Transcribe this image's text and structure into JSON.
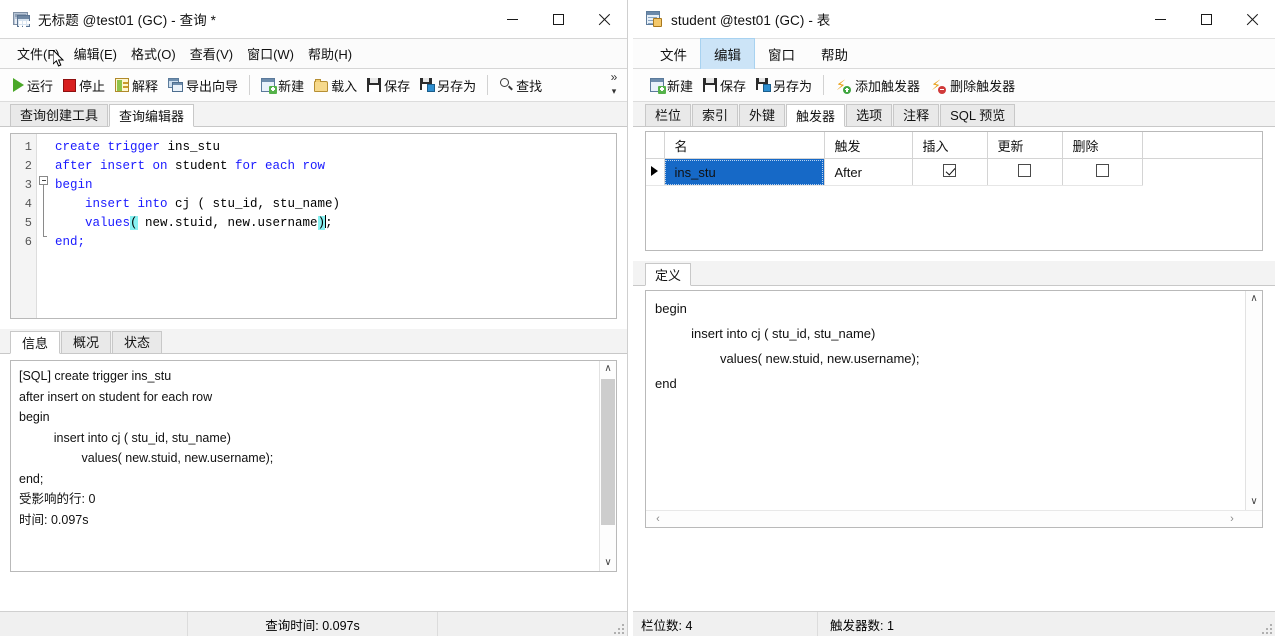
{
  "left_window": {
    "title": "无标题 @test01 (GC) - 查询 *",
    "title_icon": "query-window-icon",
    "window_buttons": {
      "minimize": "minimize-icon",
      "maximize": "maximize-icon",
      "close": "close-icon"
    },
    "menus": [
      {
        "label": "文件(F)",
        "name": "menu-file"
      },
      {
        "label": "编辑(E)",
        "name": "menu-edit"
      },
      {
        "label": "格式(O)",
        "name": "menu-format"
      },
      {
        "label": "查看(V)",
        "name": "menu-view"
      },
      {
        "label": "窗口(W)",
        "name": "menu-window"
      },
      {
        "label": "帮助(H)",
        "name": "menu-help"
      }
    ],
    "toolbar": [
      {
        "label": "运行",
        "icon": "run-icon"
      },
      {
        "label": "停止",
        "icon": "stop-icon"
      },
      {
        "label": "解释",
        "icon": "explain-icon"
      },
      {
        "label": "导出向导",
        "icon": "export-wizard-icon"
      },
      {
        "label": "新建",
        "icon": "new-icon"
      },
      {
        "label": "载入",
        "icon": "load-icon"
      },
      {
        "label": "保存",
        "icon": "save-icon"
      },
      {
        "label": "另存为",
        "icon": "save-as-icon"
      },
      {
        "label": "查找",
        "icon": "search-icon"
      }
    ],
    "toolbar_overflow": "»",
    "tabs": [
      {
        "label": "查询创建工具",
        "active": false
      },
      {
        "label": "查询编辑器",
        "active": true
      }
    ],
    "editor": {
      "line_numbers": [
        "1",
        "2",
        "3",
        "4",
        "5",
        "6"
      ],
      "lines": [
        {
          "tokens": [
            {
              "t": "create trigger ",
              "c": "kw"
            },
            {
              "t": "ins_stu",
              "c": "id"
            }
          ]
        },
        {
          "tokens": [
            {
              "t": "after insert on ",
              "c": "kw"
            },
            {
              "t": "student ",
              "c": "id"
            },
            {
              "t": "for each row",
              "c": "kw"
            }
          ]
        },
        {
          "tokens": [
            {
              "t": "begin",
              "c": "kw"
            }
          ]
        },
        {
          "tokens": [
            {
              "t": "    insert into ",
              "c": "kw"
            },
            {
              "t": "cj ( stu_id, stu_name)",
              "c": "id"
            }
          ]
        },
        {
          "tokens": [
            {
              "t": "    values",
              "c": "kw"
            },
            {
              "t": "(",
              "c": "hl"
            },
            {
              "t": " new.stuid, new.username",
              "c": "id"
            },
            {
              "t": ")",
              "c": "hl"
            },
            {
              "t": ";",
              "c": "id"
            }
          ]
        },
        {
          "tokens": [
            {
              "t": "end;",
              "c": "kw"
            }
          ]
        }
      ]
    },
    "info_tabs": [
      {
        "label": "信息",
        "active": true
      },
      {
        "label": "概况",
        "active": false
      },
      {
        "label": "状态",
        "active": false
      }
    ],
    "info_text": "[SQL] create trigger ins_stu\nafter insert on student for each row\nbegin\n          insert into cj ( stu_id, stu_name)\n                  values( new.stuid, new.username);\nend;\n受影响的行: 0\n时间: 0.097s",
    "status_bar": {
      "query_time": "查询时间: 0.097s"
    }
  },
  "right_window": {
    "title": "student @test01 (GC) - 表",
    "title_icon": "table-window-icon",
    "window_buttons": {
      "minimize": "minimize-icon",
      "maximize": "maximize-icon",
      "close": "close-icon"
    },
    "menus": [
      {
        "label": "文件",
        "name": "menu-file",
        "selected": false
      },
      {
        "label": "编辑",
        "name": "menu-edit",
        "selected": true
      },
      {
        "label": "窗口",
        "name": "menu-window",
        "selected": false
      },
      {
        "label": "帮助",
        "name": "menu-help",
        "selected": false
      }
    ],
    "toolbar": [
      {
        "label": "新建",
        "icon": "new-icon"
      },
      {
        "label": "保存",
        "icon": "save-icon"
      },
      {
        "label": "另存为",
        "icon": "save-as-icon"
      },
      {
        "label": "添加触发器",
        "icon": "add-trigger-icon"
      },
      {
        "label": "删除触发器",
        "icon": "delete-trigger-icon"
      }
    ],
    "tabs": [
      {
        "label": "栏位",
        "active": false
      },
      {
        "label": "索引",
        "active": false
      },
      {
        "label": "外键",
        "active": false
      },
      {
        "label": "触发器",
        "active": true
      },
      {
        "label": "选项",
        "active": false
      },
      {
        "label": "注释",
        "active": false
      },
      {
        "label": "SQL 预览",
        "active": false
      }
    ],
    "grid": {
      "columns": [
        "名",
        "触发",
        "插入",
        "更新",
        "删除"
      ],
      "rows": [
        {
          "selected": true,
          "名": "ins_stu",
          "触发": "After",
          "插入": true,
          "更新": false,
          "删除": false
        }
      ]
    },
    "def_tabs": [
      {
        "label": "定义",
        "active": true
      }
    ],
    "definition_text": "begin\n          insert into cj ( stu_id, stu_name)\n                  values( new.stuid, new.username);\nend",
    "status_bar": {
      "field_count": "栏位数: 4",
      "trigger_count": "触发器数: 1"
    }
  },
  "colors": {
    "selection_blue": "#1669c7",
    "menu_highlight": "#cce4f7",
    "keyword_blue": "#1a1aff",
    "bracket_highlight": "#87f2f2",
    "run_green": "#4aa828",
    "stop_red": "#d81f1f"
  }
}
